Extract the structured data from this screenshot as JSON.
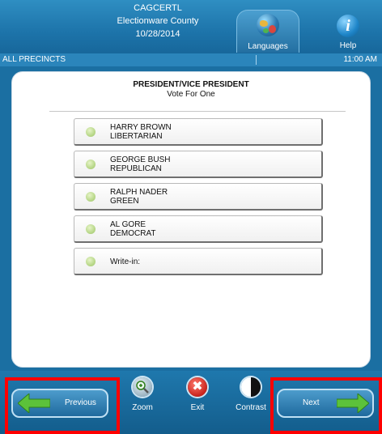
{
  "header": {
    "election_code": "CAGCERTL",
    "county": "Electionware County",
    "date": "10/28/2014",
    "languages_label": "Languages",
    "help_label": "Help",
    "help_glyph": "i"
  },
  "status": {
    "precinct": "ALL PRECINCTS",
    "time": "11:00 AM"
  },
  "contest": {
    "title": "PRESIDENT/VICE PRESIDENT",
    "instruction": "Vote For One",
    "choices": [
      {
        "name": "HARRY BROWN",
        "party": "LIBERTARIAN"
      },
      {
        "name": "GEORGE BUSH",
        "party": "REPUBLICAN"
      },
      {
        "name": "RALPH NADER",
        "party": "GREEN"
      },
      {
        "name": "AL GORE",
        "party": "DEMOCRAT"
      }
    ],
    "writein_label": "Write-in:"
  },
  "footer": {
    "previous_label": "Previous",
    "zoom_label": "Zoom",
    "exit_label": "Exit",
    "exit_glyph": "✖",
    "contrast_label": "Contrast",
    "next_label": "Next"
  },
  "colors": {
    "brand_blue": "#1b6fa2",
    "arrow_green": "#5cc23a",
    "highlight_red": "#ff0000",
    "bubble_green": "#b9d88a"
  },
  "icons": [
    "globe-icon",
    "info-icon",
    "zoom-icon",
    "exit-icon",
    "contrast-icon",
    "arrow-left-icon",
    "arrow-right-icon"
  ]
}
